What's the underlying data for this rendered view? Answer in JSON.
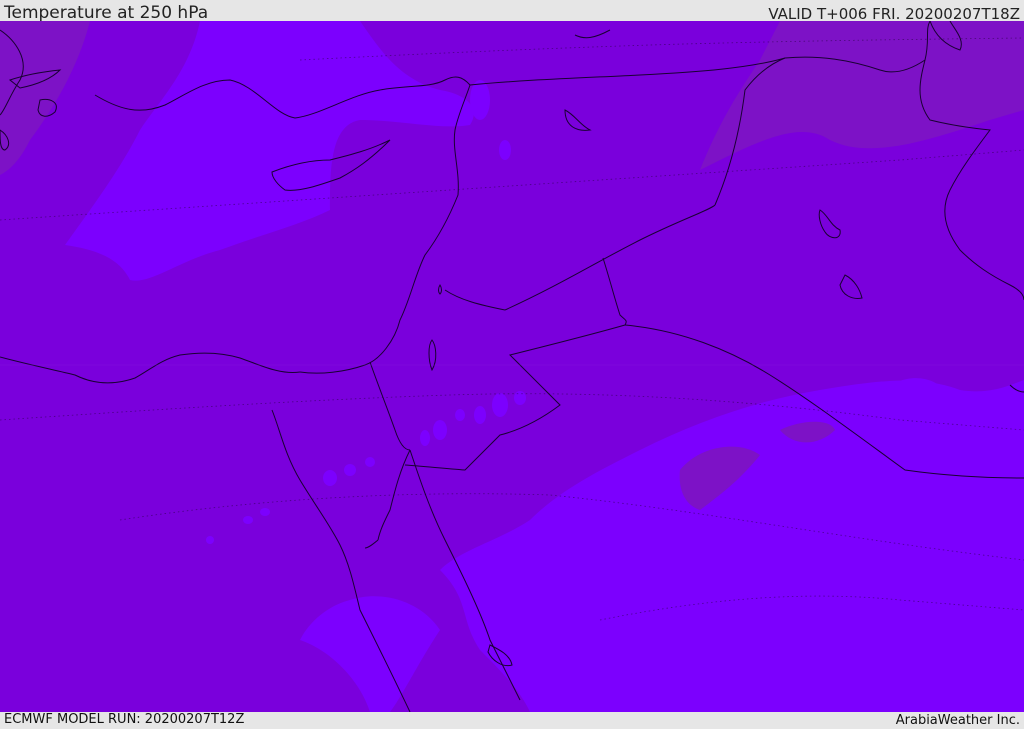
{
  "header": {
    "title": "Temperature at 250 hPa",
    "valid": "VALID T+006 FRI. 20200207T18Z"
  },
  "footer": {
    "model_run": "ECMWF MODEL RUN: 20200207T12Z",
    "credit": "ArabiaWeather Inc."
  },
  "colors": {
    "base_purple": "#7a00dc",
    "warm_purple": "#7d10c8",
    "cold_violet": "#7c00fe",
    "coastline": "#1a0033",
    "bar_background": "#e6e6e6"
  }
}
